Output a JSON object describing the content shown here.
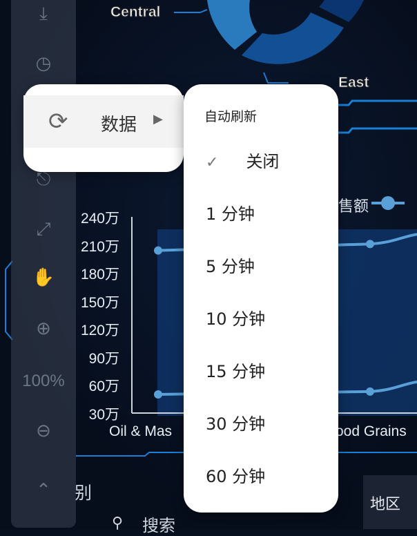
{
  "donut": {
    "labels": [
      "Central",
      "East"
    ],
    "colors": [
      "#2a7bbd",
      "#124f95",
      "#0b3570"
    ]
  },
  "chart": {
    "legend_partial": "售额",
    "x_labels": [
      "Oil & Mas",
      "ood Grains"
    ]
  },
  "chart_data": {
    "type": "line",
    "y_ticks": [
      "240万",
      "210万",
      "180万",
      "150万",
      "120万",
      "90万",
      "60万",
      "30万"
    ],
    "ylim": [
      30,
      240
    ],
    "y_unit": "万",
    "categories": [
      "Oil & Mas…",
      "…ood Grains"
    ],
    "series": [
      {
        "values": [
          204,
          211
        ]
      },
      {
        "values": [
          50,
          53
        ]
      }
    ],
    "color": "#5aa0d8"
  },
  "toolbar": {
    "zoom_level": "100%",
    "items": [
      "download",
      "refresh-clock",
      "share",
      "collapse",
      "pan",
      "zoom-in",
      "zoom-out",
      "chevron-up"
    ]
  },
  "bottom": {
    "category_partial": "别",
    "search_label": "搜索",
    "region_label": "地区"
  },
  "context_menu": {
    "item_label": "数据"
  },
  "submenu": {
    "header": "自动刷新",
    "items": [
      {
        "label": "关闭",
        "checked": true
      },
      {
        "label": "1 分钟"
      },
      {
        "label": "5 分钟"
      },
      {
        "label": "10 分钟"
      },
      {
        "label": "15 分钟"
      },
      {
        "label": "30 分钟"
      },
      {
        "label": "60 分钟"
      }
    ]
  }
}
